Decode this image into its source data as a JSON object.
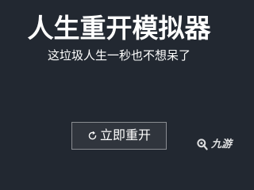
{
  "game": {
    "title": "人生重开模拟器",
    "subtitle": "这垃圾人生一秒也不想呆了"
  },
  "actions": {
    "restart_label": "立即重开",
    "restart_icon": "reload-icon"
  },
  "watermark": {
    "text": "九游",
    "icon": "jiuyou-logo-icon"
  },
  "colors": {
    "background": "#222831",
    "text": "#ffffff",
    "button_border": "#8a8d92"
  }
}
